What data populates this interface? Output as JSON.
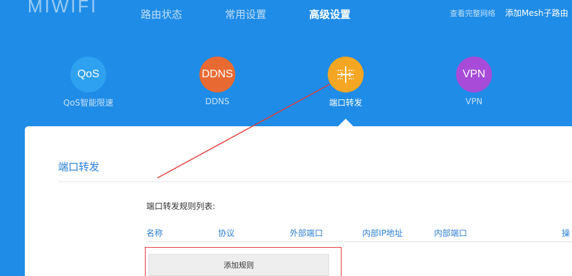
{
  "header": {
    "logo": "MIWIFI",
    "nav": [
      "路由状态",
      "常用设置",
      "高级设置"
    ],
    "links": [
      "查看完整网络",
      "添加Mesh子路由"
    ]
  },
  "tools": [
    {
      "icon_text": "QoS",
      "label": "QoS智能限速",
      "color": "#2ea1f0",
      "icon": "qos-icon"
    },
    {
      "icon_text": "DDNS",
      "label": "DDNS",
      "color": "#e86a32",
      "icon": "ddns-icon"
    },
    {
      "icon_text": "",
      "label": "端口转发",
      "color": "#f5a623",
      "icon": "port-forward-icon"
    },
    {
      "icon_text": "VPN",
      "label": "VPN",
      "color": "#a74bd8",
      "icon": "vpn-icon"
    }
  ],
  "section": {
    "title": "端口转发",
    "list_title": "端口转发规则列表:",
    "columns": [
      "名称",
      "协议",
      "外部端口",
      "内部IP地址",
      "内部端口",
      "操"
    ],
    "add_rule": "添加规则"
  },
  "colors": {
    "background": "#1f8ce7",
    "accent": "#2b7fd6",
    "annotation": "#e23b3b"
  }
}
